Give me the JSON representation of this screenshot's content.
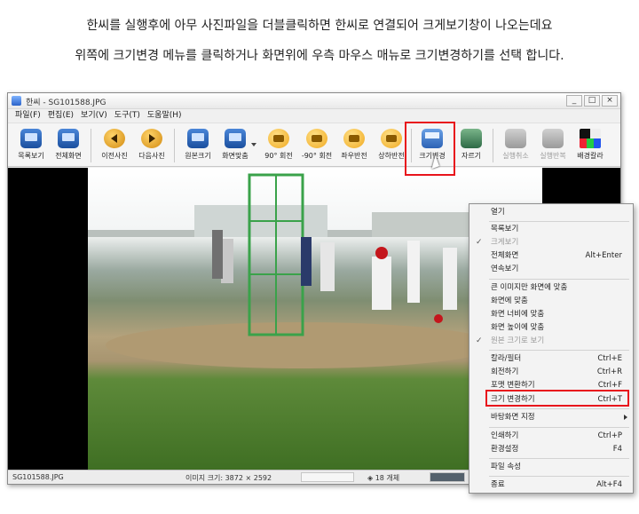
{
  "caption": {
    "line1": "한씨를 실행후에 아무 사진파일을 더블클릭하면 한씨로 연결되어 크게보기창이 나오는데요",
    "line2": "위쪽에 크기변경 메뉴를 클릭하거나 화면위에 우측 마우스 매뉴로 크기변경하기를 선택 합니다."
  },
  "window": {
    "title": "한씨 - SG101588.JPG",
    "buttons": {
      "min": "_",
      "max": "□",
      "close": "×"
    }
  },
  "menu": [
    "파일(F)",
    "편집(E)",
    "보기(V)",
    "도구(T)",
    "도움말(H)"
  ],
  "toolbar": [
    {
      "label": "목록보기",
      "icon": "list-view-icon"
    },
    {
      "label": "전체화면",
      "icon": "fullscreen-icon"
    },
    {
      "label": "이전사진",
      "icon": "previous-icon"
    },
    {
      "label": "다음사진",
      "icon": "next-icon"
    },
    {
      "label": "원본크기",
      "icon": "original-size-icon"
    },
    {
      "label": "화면맞춤",
      "icon": "fit-screen-icon"
    },
    {
      "label": "90° 회전",
      "icon": "rotate-cw-icon"
    },
    {
      "label": "-90° 회전",
      "icon": "rotate-ccw-icon"
    },
    {
      "label": "좌우반전",
      "icon": "flip-horizontal-icon"
    },
    {
      "label": "상하반전",
      "icon": "flip-vertical-icon"
    },
    {
      "label": "크기변경",
      "icon": "resize-icon"
    },
    {
      "label": "자르기",
      "icon": "crop-icon"
    },
    {
      "label": "실행취소",
      "icon": "undo-icon"
    },
    {
      "label": "실행반복",
      "icon": "redo-icon"
    },
    {
      "label": "배경칼라",
      "icon": "background-color-icon"
    }
  ],
  "status": {
    "filename": "SG101588.JPG",
    "image_size": "이미지 크기: 3872 × 2592",
    "count": "◈ 18 개체"
  },
  "context_menu": [
    {
      "label": "열기",
      "shortcut": ""
    },
    {
      "label": "목록보기",
      "shortcut": ""
    },
    {
      "label": "크게보기",
      "shortcut": ""
    },
    {
      "label": "전체화면",
      "shortcut": "Alt+Enter"
    },
    {
      "label": "연속보기",
      "shortcut": ""
    },
    {
      "label": "큰 이미지만 화면에 맞춤",
      "shortcut": ""
    },
    {
      "label": "화면에 맞춤",
      "shortcut": ""
    },
    {
      "label": "화면 너비에 맞춤",
      "shortcut": ""
    },
    {
      "label": "화면 높이에 맞춤",
      "shortcut": ""
    },
    {
      "label": "원본 크기로 보기",
      "shortcut": ""
    },
    {
      "label": "칼라/필터",
      "shortcut": "Ctrl+E"
    },
    {
      "label": "회전하기",
      "shortcut": "Ctrl+R"
    },
    {
      "label": "포맷 변환하기",
      "shortcut": "Ctrl+F"
    },
    {
      "label": "크기 변경하기",
      "shortcut": "Ctrl+T"
    },
    {
      "label": "바탕화면 지정",
      "shortcut": ""
    },
    {
      "label": "인쇄하기",
      "shortcut": "Ctrl+P"
    },
    {
      "label": "환경설정",
      "shortcut": "F4"
    },
    {
      "label": "파일 속성",
      "shortcut": ""
    },
    {
      "label": "종료",
      "shortcut": "Alt+F4"
    }
  ],
  "colors": {
    "highlight": "#e8141c",
    "accent": "#2a62c9",
    "field": "#3f6f23"
  }
}
